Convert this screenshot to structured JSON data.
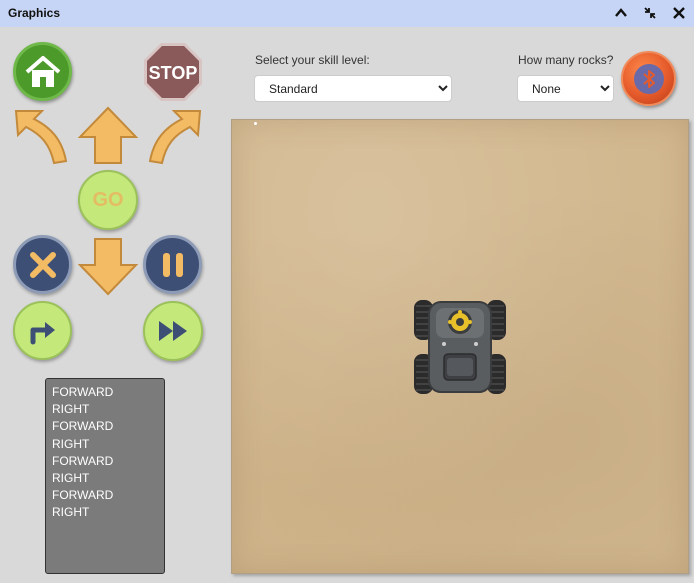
{
  "window": {
    "title": "Graphics",
    "controls": [
      "chevron-up-icon",
      "collapse-icon",
      "close-icon"
    ]
  },
  "controls": {
    "home_icon": "home-icon",
    "stop_label": "STOP",
    "go_label": "GO"
  },
  "skill": {
    "label": "Select your skill level:",
    "selected": "Standard"
  },
  "rocks": {
    "label": "How many rocks?",
    "selected": "None"
  },
  "bluetooth_icon": "bluetooth-icon",
  "commands": [
    "FORWARD",
    "RIGHT",
    "FORWARD",
    "RIGHT",
    "FORWARD",
    "RIGHT",
    "FORWARD",
    "RIGHT"
  ],
  "colors": {
    "titlebar": "#c6d5f5",
    "home_green": "#4c9a2a",
    "stop_red": "#8a5a5a",
    "arrow_orange": "#f2bb64",
    "go_green": "#c4e87a",
    "navy": "#3e4f76",
    "sand": "#d2b88f",
    "list_gray": "#7b7b7b",
    "bt_orange": "#e55a2b"
  }
}
